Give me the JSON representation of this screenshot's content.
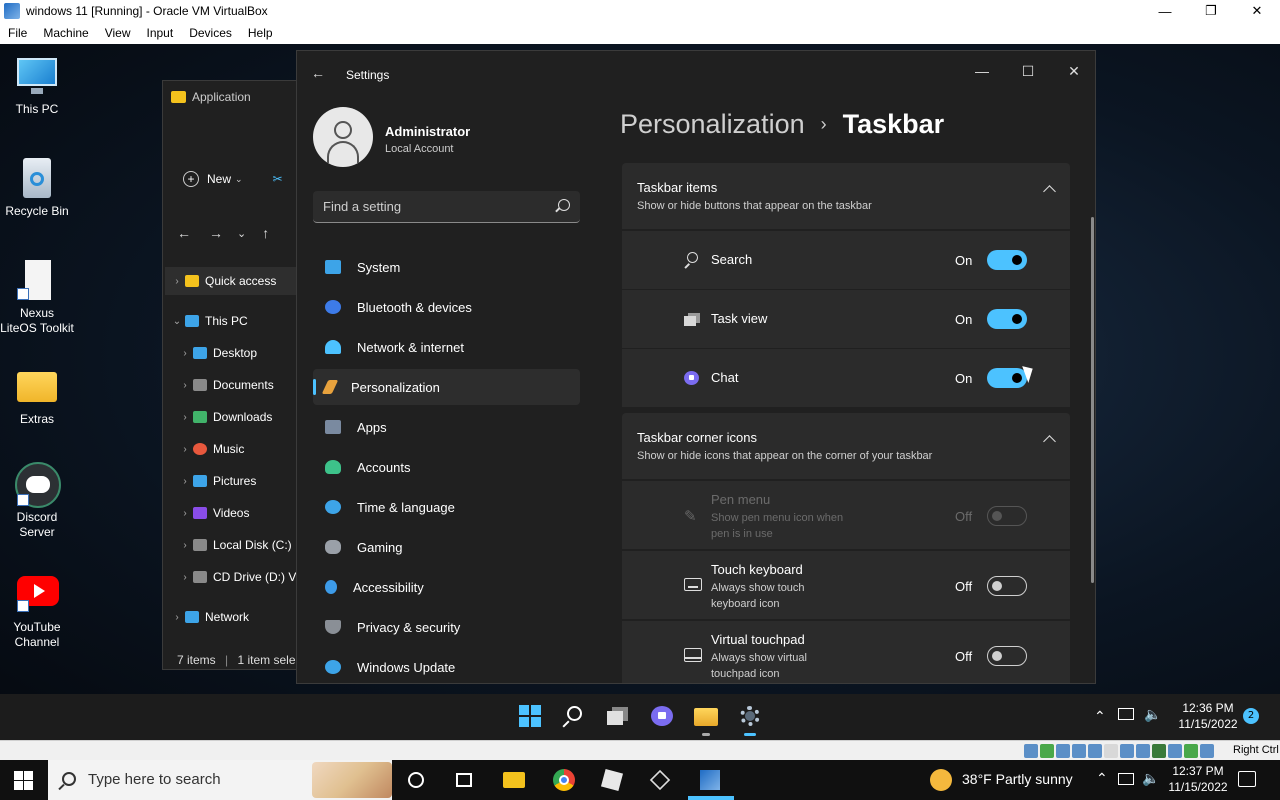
{
  "host": {
    "title": "windows 11 [Running] - Oracle VM VirtualBox",
    "controls": {
      "minimize": "—",
      "restore": "❐",
      "close": "✕"
    },
    "menu": [
      "File",
      "Machine",
      "View",
      "Input",
      "Devices",
      "Help"
    ],
    "status_right": "Right Ctrl"
  },
  "desktop_icons": [
    {
      "label": "This PC",
      "icon": "monitor-icon"
    },
    {
      "label": "Recycle Bin",
      "icon": "recycle-bin-icon"
    },
    {
      "label": "Nexus LiteOS Toolkit",
      "icon": "document-icon"
    },
    {
      "label": "Extras",
      "icon": "folder-icon"
    },
    {
      "label": "Discord Server",
      "icon": "discord-icon"
    },
    {
      "label": "YouTube Channel",
      "icon": "youtube-icon"
    }
  ],
  "explorer": {
    "title": "Application",
    "new_label": "New",
    "tree": [
      {
        "label": "Quick access",
        "color": "#f4c21d"
      },
      {
        "label": "This PC",
        "color": "#3da4e8"
      },
      {
        "label": "Desktop",
        "color": "#3da4e8"
      },
      {
        "label": "Documents",
        "color": "#8a8a8a"
      },
      {
        "label": "Downloads",
        "color": "#41b36a"
      },
      {
        "label": "Music",
        "color": "#e8583d"
      },
      {
        "label": "Pictures",
        "color": "#3da4e8"
      },
      {
        "label": "Videos",
        "color": "#8a4de8"
      },
      {
        "label": "Local Disk (C:)",
        "color": "#8a8a8a"
      },
      {
        "label": "CD Drive (D:) V",
        "color": "#8a8a8a"
      },
      {
        "label": "Network",
        "color": "#3da4e8"
      }
    ],
    "status_items": "7 items",
    "status_selected": "1 item selec"
  },
  "settings": {
    "window_title": "Settings",
    "controls": {
      "minimize": "—",
      "maximize": "☐",
      "close": "✕"
    },
    "profile": {
      "name": "Administrator",
      "account": "Local Account"
    },
    "search_placeholder": "Find a setting",
    "nav": [
      {
        "label": "System",
        "color": "#3da4e8"
      },
      {
        "label": "Bluetooth & devices",
        "color": "#3d7be8"
      },
      {
        "label": "Network & internet",
        "color": "#4cc2ff"
      },
      {
        "label": "Personalization",
        "color": "#e8a23d"
      },
      {
        "label": "Apps",
        "color": "#7a8aa0"
      },
      {
        "label": "Accounts",
        "color": "#3dc28a"
      },
      {
        "label": "Time & language",
        "color": "#3da4e8"
      },
      {
        "label": "Gaming",
        "color": "#9aa0a8"
      },
      {
        "label": "Accessibility",
        "color": "#3d9be8"
      },
      {
        "label": "Privacy & security",
        "color": "#8a8f96"
      },
      {
        "label": "Windows Update",
        "color": "#3da4e8"
      }
    ],
    "breadcrumb": {
      "parent": "Personalization",
      "separator": "›",
      "current": "Taskbar"
    },
    "taskbar_items": {
      "title": "Taskbar items",
      "subtitle": "Show or hide buttons that appear on the taskbar",
      "rows": [
        {
          "label": "Search",
          "state": "On"
        },
        {
          "label": "Task view",
          "state": "On"
        },
        {
          "label": "Chat",
          "state": "On"
        }
      ]
    },
    "corner_icons": {
      "title": "Taskbar corner icons",
      "subtitle": "Show or hide icons that appear on the corner of your taskbar",
      "rows": [
        {
          "label": "Pen menu",
          "sub": "Show pen menu icon when pen is in use",
          "state": "Off"
        },
        {
          "label": "Touch keyboard",
          "sub": "Always show touch keyboard icon",
          "state": "Off"
        },
        {
          "label": "Virtual touchpad",
          "sub": "Always show virtual touchpad icon",
          "state": "Off"
        }
      ]
    }
  },
  "guest_taskbar": {
    "time": "12:36 PM",
    "date": "11/15/2022",
    "notifications": "2"
  },
  "host_taskbar": {
    "search_placeholder": "Type here to search",
    "weather": "38°F  Partly sunny",
    "time": "12:37 PM",
    "date": "11/15/2022"
  }
}
